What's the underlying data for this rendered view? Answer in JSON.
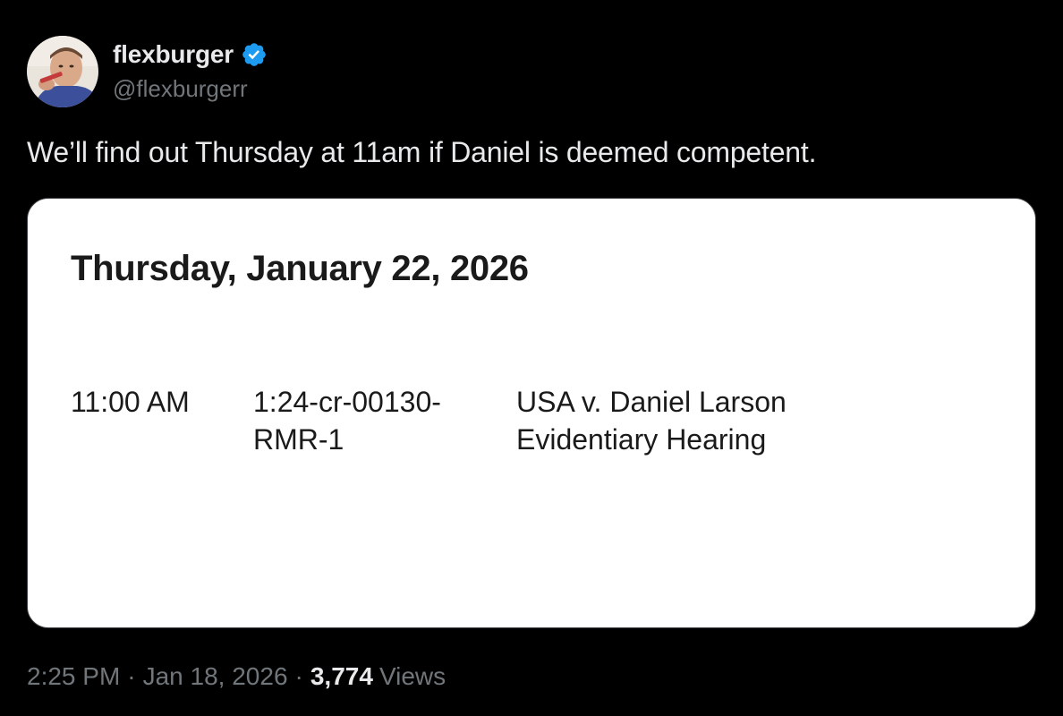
{
  "author": {
    "display_name": "flexburger",
    "handle": "@flexburgerr",
    "verified_icon": "verified-badge-icon",
    "verified_color": "#1d9bf0"
  },
  "tweet": {
    "text": "We’ll find out Thursday at 11am if Daniel is deemed competent."
  },
  "media": {
    "date_heading": "Thursday, January 22, 2026",
    "time": "11:00 AM",
    "case_number_line1": "1:24-cr-00130-",
    "case_number_line2": "RMR-1",
    "case_title_line1": "USA v. Daniel Larson",
    "case_title_line2": "Evidentiary Hearing"
  },
  "meta": {
    "time": "2:25 PM",
    "separator": "·",
    "date": "Jan 18, 2026",
    "views_count": "3,774",
    "views_label": "Views"
  },
  "colors": {
    "background": "#000000",
    "text_primary": "#e7e9ea",
    "text_secondary": "#71767b",
    "card_background": "#ffffff"
  }
}
